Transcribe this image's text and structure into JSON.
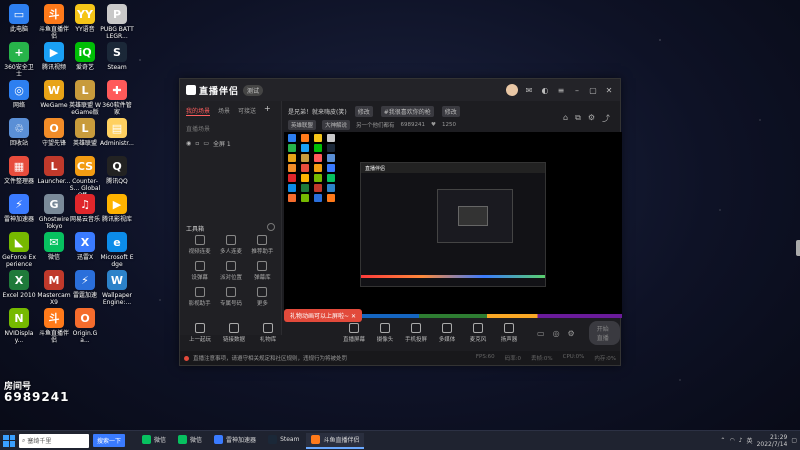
{
  "desktop": {
    "icons": [
      {
        "label": "此电脑",
        "color": "#2d7ff0",
        "glyph": "▭"
      },
      {
        "label": "斗鱼直播伴侣",
        "color": "#ff7a1a",
        "glyph": "斗"
      },
      {
        "label": "YY语音",
        "color": "#f5c518",
        "glyph": "YY"
      },
      {
        "label": "PUBG BATTLEGR...",
        "color": "#c9c9c9",
        "glyph": "P"
      },
      {
        "label": "360安全卫士",
        "color": "#27b34a",
        "glyph": "+"
      },
      {
        "label": "腾讯视频",
        "color": "#1aa0f5",
        "glyph": "▶"
      },
      {
        "label": "爱奇艺",
        "color": "#00be06",
        "glyph": "iQ"
      },
      {
        "label": "Steam",
        "color": "#1b2838",
        "glyph": "S"
      },
      {
        "label": "网络",
        "color": "#2d7ff0",
        "glyph": "◎"
      },
      {
        "label": "WeGame",
        "color": "#e8a317",
        "glyph": "W"
      },
      {
        "label": "英雄联盟 WeGame版",
        "color": "#c89b3c",
        "glyph": "L"
      },
      {
        "label": "360软件管家",
        "color": "#ff5a5a",
        "glyph": "✚"
      },
      {
        "label": "回收站",
        "color": "#5a8fd6",
        "glyph": "♲"
      },
      {
        "label": "守望先锋",
        "color": "#f28c28",
        "glyph": "O"
      },
      {
        "label": "英雄联盟",
        "color": "#c89b3c",
        "glyph": "L"
      },
      {
        "label": "Administr...",
        "color": "#ffd060",
        "glyph": "▤"
      },
      {
        "label": "文件整理器",
        "color": "#e74c3c",
        "glyph": "▦"
      },
      {
        "label": "Launcher...",
        "color": "#c0392b",
        "glyph": "L"
      },
      {
        "label": "Counter-S... Global Off...",
        "color": "#f39c12",
        "glyph": "CS"
      },
      {
        "label": "腾讯QQ",
        "color": "#222",
        "glyph": "Q"
      },
      {
        "label": "雷神加速器",
        "color": "#3a7bff",
        "glyph": "⚡"
      },
      {
        "label": "Ghostwire Tokyo",
        "color": "#7a8a99",
        "glyph": "G"
      },
      {
        "label": "网易云音乐",
        "color": "#e0262b",
        "glyph": "♫"
      },
      {
        "label": "腾讯影视库",
        "color": "#ffb300",
        "glyph": "▶"
      },
      {
        "label": "GeForce Experience",
        "color": "#76b900",
        "glyph": "◣"
      },
      {
        "label": "微信",
        "color": "#07c160",
        "glyph": "✉"
      },
      {
        "label": "迅雷X",
        "color": "#3a7bff",
        "glyph": "X"
      },
      {
        "label": "Microsoft Edge",
        "color": "#0c8ce9",
        "glyph": "e"
      },
      {
        "label": "Excel 2010",
        "color": "#1f7a3a",
        "glyph": "X"
      },
      {
        "label": "Mastercam X9",
        "color": "#c0392b",
        "glyph": "M"
      },
      {
        "label": "雷霆加速",
        "color": "#2a6fdb",
        "glyph": "⚡"
      },
      {
        "label": "Wallpaper Engine:...",
        "color": "#2c82c9",
        "glyph": "W"
      },
      {
        "label": "NVIDisplay...",
        "color": "#76b900",
        "glyph": "N"
      },
      {
        "label": "斗鱼直播伴侣",
        "color": "#ff7a1a",
        "glyph": "斗"
      },
      {
        "label": "Origin.Ga...",
        "color": "#f56c2d",
        "glyph": "O"
      }
    ]
  },
  "app": {
    "logo_text": "直播伴侣",
    "version_badge": "测试",
    "tabs": [
      "我的场景",
      "场景",
      "可接送"
    ],
    "add_tab": "+",
    "scene_header": "直播场景",
    "scene_item": "全屏 1",
    "header": {
      "title": "是兄弟！就来嗨皮(笑)",
      "tag1": "修改",
      "tag2": "#我很喜欢你的枪",
      "tag3": "修改",
      "category1": "英雄联盟",
      "category2": "大神解说",
      "room_label": "另一个他们都有",
      "room_id": "6989241",
      "fans": "1250"
    },
    "tools_title": "工具箱",
    "tools": [
      {
        "label": "视频连麦"
      },
      {
        "label": "多人连麦"
      },
      {
        "label": "推荐助手"
      },
      {
        "label": "设弹幕"
      },
      {
        "label": "派对位置"
      },
      {
        "label": "弹幕库"
      },
      {
        "label": "影视助手"
      },
      {
        "label": "专属号码"
      },
      {
        "label": "更多"
      }
    ],
    "toast": "礼物动画可以上屏啦~",
    "bottom_left": [
      {
        "label": "上一起玩"
      },
      {
        "label": "链接数据"
      },
      {
        "label": "礼物库"
      }
    ],
    "bottom_mid": [
      {
        "label": "直播屏幕"
      },
      {
        "label": "摄像头"
      },
      {
        "label": "手机投屏"
      },
      {
        "label": "多媒体"
      },
      {
        "label": "麦克风"
      },
      {
        "label": "扬声器"
      }
    ],
    "start_button": "开始直播",
    "status_text": "直播注意事项，请遵守相关规定和社区规则，违规行为将被处罚",
    "status_right": [
      "FPS:60",
      "码率:0",
      "丢帧:0%",
      "CPU:0%",
      "内存:0%"
    ]
  },
  "room_overlay": {
    "label": "房间号",
    "number": "6989241"
  },
  "taskbar": {
    "search_placeholder": "塞绮千里",
    "search_button": "搜索一下",
    "items": [
      {
        "label": "微信",
        "color": "#07c160",
        "active": false
      },
      {
        "label": "微信",
        "color": "#07c160",
        "active": false
      },
      {
        "label": "雷神加速器",
        "color": "#3a7bff",
        "active": false
      },
      {
        "label": "Steam",
        "color": "#1b2838",
        "active": false
      },
      {
        "label": "斗鱼直播伴侣",
        "color": "#ff7a1a",
        "active": true
      }
    ],
    "tray_time": "21:29",
    "tray_date": "2022/7/14",
    "tray_lang": "英"
  }
}
